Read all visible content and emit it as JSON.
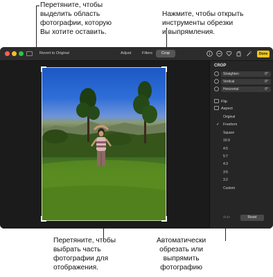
{
  "callouts": {
    "top_left": [
      "Перетяните, чтобы",
      "выделить область",
      "фотографии, которую",
      "Вы хотите оставить."
    ],
    "top_right": [
      "Нажмите, чтобы открыть",
      "инструменты обрезки",
      "и выпрямления."
    ],
    "bottom_left": [
      "Перетяните, чтобы",
      "выбрать часть",
      "фотографии для",
      "отображения."
    ],
    "bottom_right": [
      "Автоматически",
      "обрезать или",
      "выпрямить",
      "фотографию"
    ]
  },
  "toolbar": {
    "revert_label": "Revert to Original",
    "tabs": [
      {
        "label": "Adjust",
        "active": false
      },
      {
        "label": "Filters",
        "active": false
      },
      {
        "label": "Crop",
        "active": true
      }
    ],
    "icons": [
      "info-icon",
      "minus-circle-icon",
      "heart-icon",
      "rotate-icon",
      "share-icon",
      "magic-wand-icon"
    ],
    "done_label": "Done",
    "done_color": "#f5c518"
  },
  "panel": {
    "title": "CROP",
    "sliders": [
      {
        "label": "Straighten",
        "value": "0°"
      },
      {
        "label": "Vertical",
        "value": "0°"
      },
      {
        "label": "Horizontal",
        "value": "0°"
      }
    ],
    "flip_label": "Flip",
    "aspect_label": "Aspect",
    "aspect_options": [
      {
        "label": "Original",
        "checked": false
      },
      {
        "label": "Freeform",
        "checked": true
      },
      {
        "label": "Square",
        "checked": false
      },
      {
        "label": "16:9",
        "checked": false
      },
      {
        "label": "4:5",
        "checked": false
      },
      {
        "label": "5:7",
        "checked": false
      },
      {
        "label": "4:3",
        "checked": false
      },
      {
        "label": "3:5",
        "checked": false
      },
      {
        "label": "3:2",
        "checked": false
      },
      {
        "label": "Custom",
        "checked": false
      }
    ],
    "auto_label": "Auto",
    "reset_label": "Reset",
    "check_glyph": "✓"
  }
}
